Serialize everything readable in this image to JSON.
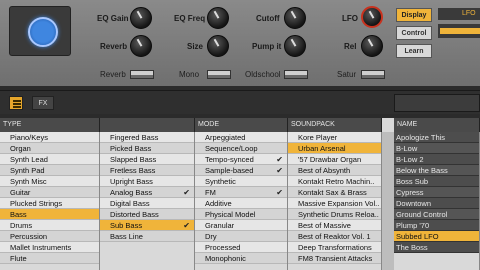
{
  "knobs": [
    {
      "label": "EQ Gain"
    },
    {
      "label": "EQ Freq"
    },
    {
      "label": "Cutoff"
    },
    {
      "label": "LFO"
    },
    {
      "label": "Reverb"
    },
    {
      "label": "Size"
    },
    {
      "label": "Pump it"
    },
    {
      "label": "Rel"
    }
  ],
  "switches": [
    {
      "label": "Reverb"
    },
    {
      "label": "Mono"
    },
    {
      "label": "Oldschool"
    },
    {
      "label": "Satur"
    }
  ],
  "side_buttons": {
    "display": "Display",
    "control": "Control",
    "learn": "Learn"
  },
  "lfo_tag": "LFO",
  "toolbar": {
    "fx_label": "FX"
  },
  "columns": {
    "type": {
      "header": "Type",
      "items": [
        "Piano/Keys",
        "Organ",
        "Synth Lead",
        "Synth Pad",
        "Synth Misc",
        "Guitar",
        "Plucked Strings",
        "Bass",
        "Drums",
        "Percussion",
        "Mallet Instruments",
        "Flute"
      ],
      "selected": 7
    },
    "subtype": {
      "header": "",
      "items": [
        "Fingered Bass",
        "Picked Bass",
        "Slapped Bass",
        "Fretless Bass",
        "Upright Bass",
        "Analog Bass",
        "Digital Bass",
        "Distorted Bass",
        "Sub Bass",
        "Bass Line"
      ],
      "selected": 8,
      "checks": [
        5,
        8
      ]
    },
    "mode": {
      "header": "Mode",
      "items": [
        "Arpeggiated",
        "Sequence/Loop",
        "Tempo-synced",
        "Sample-based",
        "Synthetic",
        "FM",
        "Additive",
        "Physical Model",
        "Granular",
        "Dry",
        "Processed",
        "Monophonic"
      ],
      "checks": [
        2,
        3,
        5
      ]
    },
    "soundpack": {
      "header": "Soundpack",
      "items": [
        "Kore Player",
        "Urban Arsenal",
        "'57 Drawbar Organ",
        "Best of Absynth",
        "Kontakt Retro Machin..",
        "Kontakt Sax & Brass",
        "Massive Expansion Vol..",
        "Synthetic Drums Reloa..",
        "Best of Massive",
        "Best of Reaktor Vol. 1",
        "Deep Transformations",
        "FM8 Transient Attacks"
      ],
      "selected": 1
    },
    "name": {
      "header": "Name",
      "items": [
        "Apologize This",
        "B-Low",
        "B-Low 2",
        "Below the Bass",
        "Boss Sub",
        "Cypress",
        "Downtown",
        "Ground Control",
        "Plump '70",
        "Subbed LFO",
        "The Boss"
      ],
      "selected": 9
    }
  },
  "colors": {
    "accent": "#f0b43a",
    "main_knob": "#3f86e0",
    "lfo_knob_ring": "#c8321e"
  }
}
